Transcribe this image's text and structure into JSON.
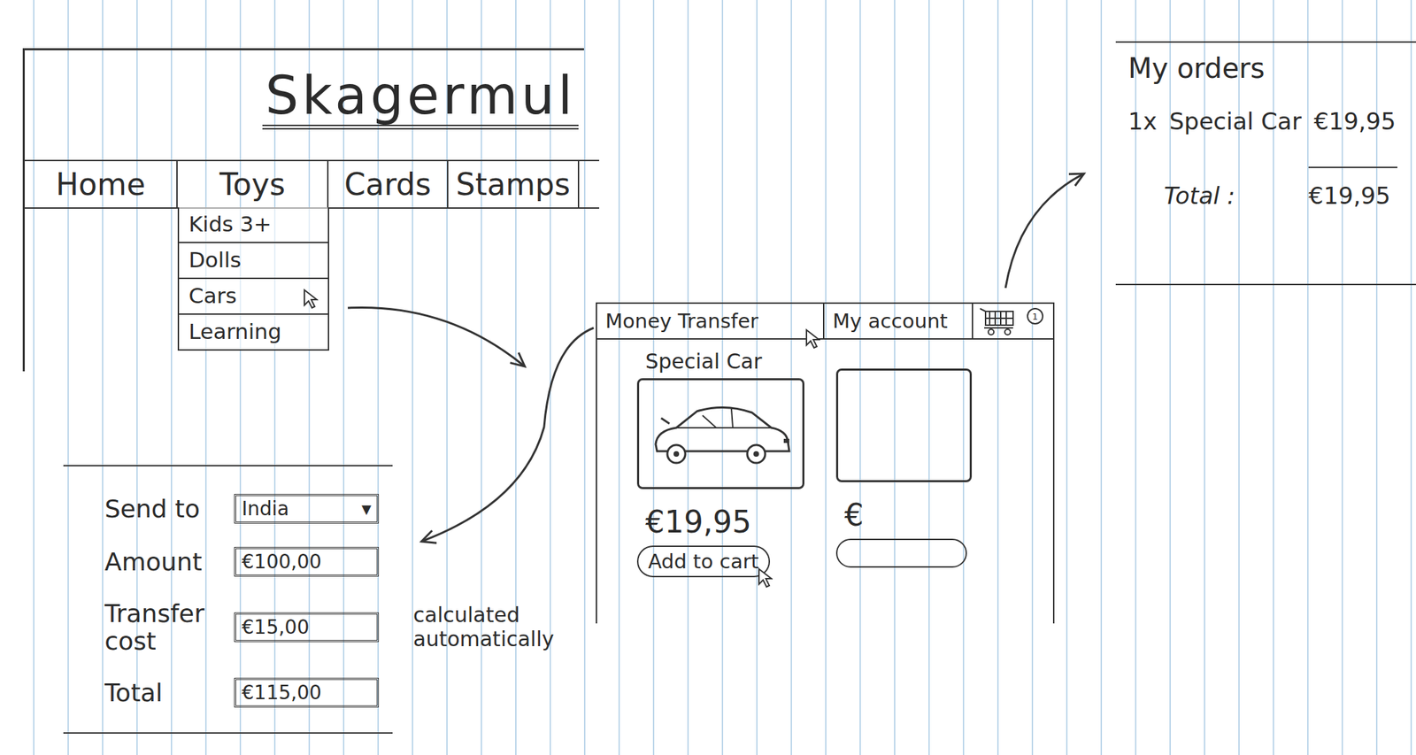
{
  "header": {
    "logo": "Skagermul",
    "nav": [
      {
        "label": "Home",
        "selected": false
      },
      {
        "label": "Toys",
        "selected": true
      },
      {
        "label": "Cards",
        "selected": false
      },
      {
        "label": "Stamps",
        "selected": false
      }
    ],
    "dropdown": [
      {
        "label": "Kids 3+",
        "hovered": false
      },
      {
        "label": "Dolls",
        "hovered": false
      },
      {
        "label": "Cars",
        "hovered": true
      },
      {
        "label": "Learning",
        "hovered": false
      }
    ]
  },
  "shop": {
    "tabs": [
      {
        "label": "Money Transfer",
        "hovered": true
      },
      {
        "label": "My account",
        "hovered": false
      }
    ],
    "cart": {
      "badge": "1"
    },
    "products": [
      {
        "kind": "filled",
        "name": "Special Car",
        "price": "€19,95",
        "button": "Add to cart",
        "hovered": true
      },
      {
        "kind": "empty",
        "price": "€"
      }
    ]
  },
  "transfer_form": {
    "fields": [
      {
        "label": "Send to",
        "value": "India",
        "kind": "select",
        "arrow": "▾"
      },
      {
        "label": "Amount",
        "value": "€100,00",
        "kind": "input"
      },
      {
        "label": "Transfer cost",
        "value": "€15,00",
        "kind": "input",
        "note": "calculated automatically"
      },
      {
        "label": "Total",
        "value": "€115,00",
        "kind": "input"
      }
    ]
  },
  "orders": {
    "title": "My orders",
    "items": [
      {
        "qty": "1x",
        "name": "Special Car",
        "price": "€19,95"
      }
    ],
    "total_label": "Total :",
    "total": "€19,95"
  }
}
